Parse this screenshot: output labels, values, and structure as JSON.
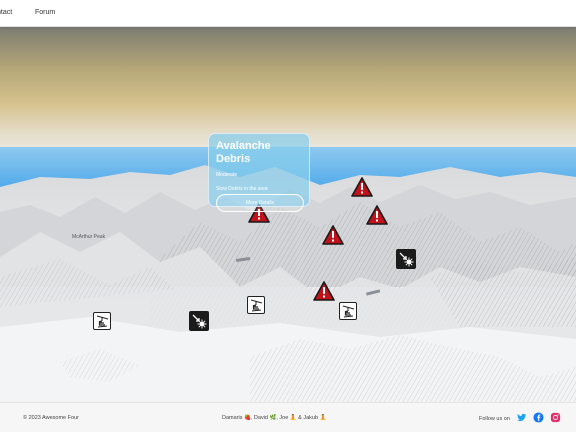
{
  "nav": {
    "contact": "ntact",
    "forum": "Forum"
  },
  "map": {
    "place_label": "McArthur Peak"
  },
  "popup": {
    "title": "Avalanche Debris",
    "severity": "Moderate",
    "description": "Slow Debris in the area",
    "button": "More Details"
  },
  "footer": {
    "copyright": "© 2023 Awesome Four",
    "credits": "Damaris 🍓, David 🌿, Joe 🧘 & Jakub 🧘",
    "follow": "Follow us on"
  },
  "colors": {
    "twitter": "#1da1f2",
    "facebook": "#1877f2",
    "instagram": "#e1306c",
    "hazard": "#c0121a",
    "popup": "#87cdeb"
  },
  "icons": [
    "warning-icon",
    "ski-lift-icon",
    "avalanche-icon",
    "twitter-icon",
    "facebook-icon",
    "instagram-icon"
  ]
}
